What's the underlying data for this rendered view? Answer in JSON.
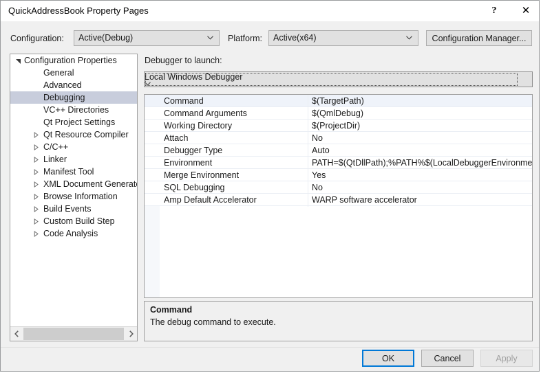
{
  "window": {
    "title": "QuickAddressBook Property Pages",
    "help_glyph": "?",
    "close_glyph": "✕"
  },
  "config_bar": {
    "configuration_label": "Configuration:",
    "configuration_value": "Active(Debug)",
    "platform_label": "Platform:",
    "platform_value": "Active(x64)",
    "configuration_manager_label": "Configuration Manager..."
  },
  "tree": {
    "items": [
      {
        "label": "Configuration Properties",
        "depth": 0,
        "twisty": "expanded",
        "selected": false
      },
      {
        "label": "General",
        "depth": 1,
        "twisty": "none",
        "selected": false
      },
      {
        "label": "Advanced",
        "depth": 1,
        "twisty": "none",
        "selected": false
      },
      {
        "label": "Debugging",
        "depth": 1,
        "twisty": "none",
        "selected": true
      },
      {
        "label": "VC++ Directories",
        "depth": 1,
        "twisty": "none",
        "selected": false
      },
      {
        "label": "Qt Project Settings",
        "depth": 1,
        "twisty": "none",
        "selected": false
      },
      {
        "label": "Qt Resource Compiler",
        "depth": 1,
        "twisty": "collapsed",
        "selected": false
      },
      {
        "label": "C/C++",
        "depth": 1,
        "twisty": "collapsed",
        "selected": false
      },
      {
        "label": "Linker",
        "depth": 1,
        "twisty": "collapsed",
        "selected": false
      },
      {
        "label": "Manifest Tool",
        "depth": 1,
        "twisty": "collapsed",
        "selected": false
      },
      {
        "label": "XML Document Generator",
        "depth": 1,
        "twisty": "collapsed",
        "selected": false
      },
      {
        "label": "Browse Information",
        "depth": 1,
        "twisty": "collapsed",
        "selected": false
      },
      {
        "label": "Build Events",
        "depth": 1,
        "twisty": "collapsed",
        "selected": false
      },
      {
        "label": "Custom Build Step",
        "depth": 1,
        "twisty": "collapsed",
        "selected": false
      },
      {
        "label": "Code Analysis",
        "depth": 1,
        "twisty": "collapsed",
        "selected": false
      }
    ],
    "scrollbar": {
      "left_arrow": "❮",
      "right_arrow": "❯"
    }
  },
  "main": {
    "debugger_launch_label": "Debugger to launch:",
    "debugger_launch_value": "Local Windows Debugger",
    "grid": {
      "rows": [
        {
          "name": "Command",
          "value": "$(TargetPath)",
          "selected": true
        },
        {
          "name": "Command Arguments",
          "value": "$(QmlDebug)",
          "selected": false
        },
        {
          "name": "Working Directory",
          "value": "$(ProjectDir)",
          "selected": false
        },
        {
          "name": "Attach",
          "value": "No",
          "selected": false
        },
        {
          "name": "Debugger Type",
          "value": "Auto",
          "selected": false
        },
        {
          "name": "Environment",
          "value": "PATH=$(QtDllPath);%PATH%$(LocalDebuggerEnvironment)",
          "selected": false
        },
        {
          "name": "Merge Environment",
          "value": "Yes",
          "selected": false
        },
        {
          "name": "SQL Debugging",
          "value": "No",
          "selected": false
        },
        {
          "name": "Amp Default Accelerator",
          "value": "WARP software accelerator",
          "selected": false
        }
      ]
    },
    "description": {
      "title": "Command",
      "body": "The debug command to execute."
    }
  },
  "footer": {
    "ok_label": "OK",
    "cancel_label": "Cancel",
    "apply_label": "Apply"
  },
  "colors": {
    "accent": "#0078d7",
    "dialog_bg": "#f0f0f0",
    "selection": "#c8cddc",
    "grid_selection": "#eff3fa"
  }
}
